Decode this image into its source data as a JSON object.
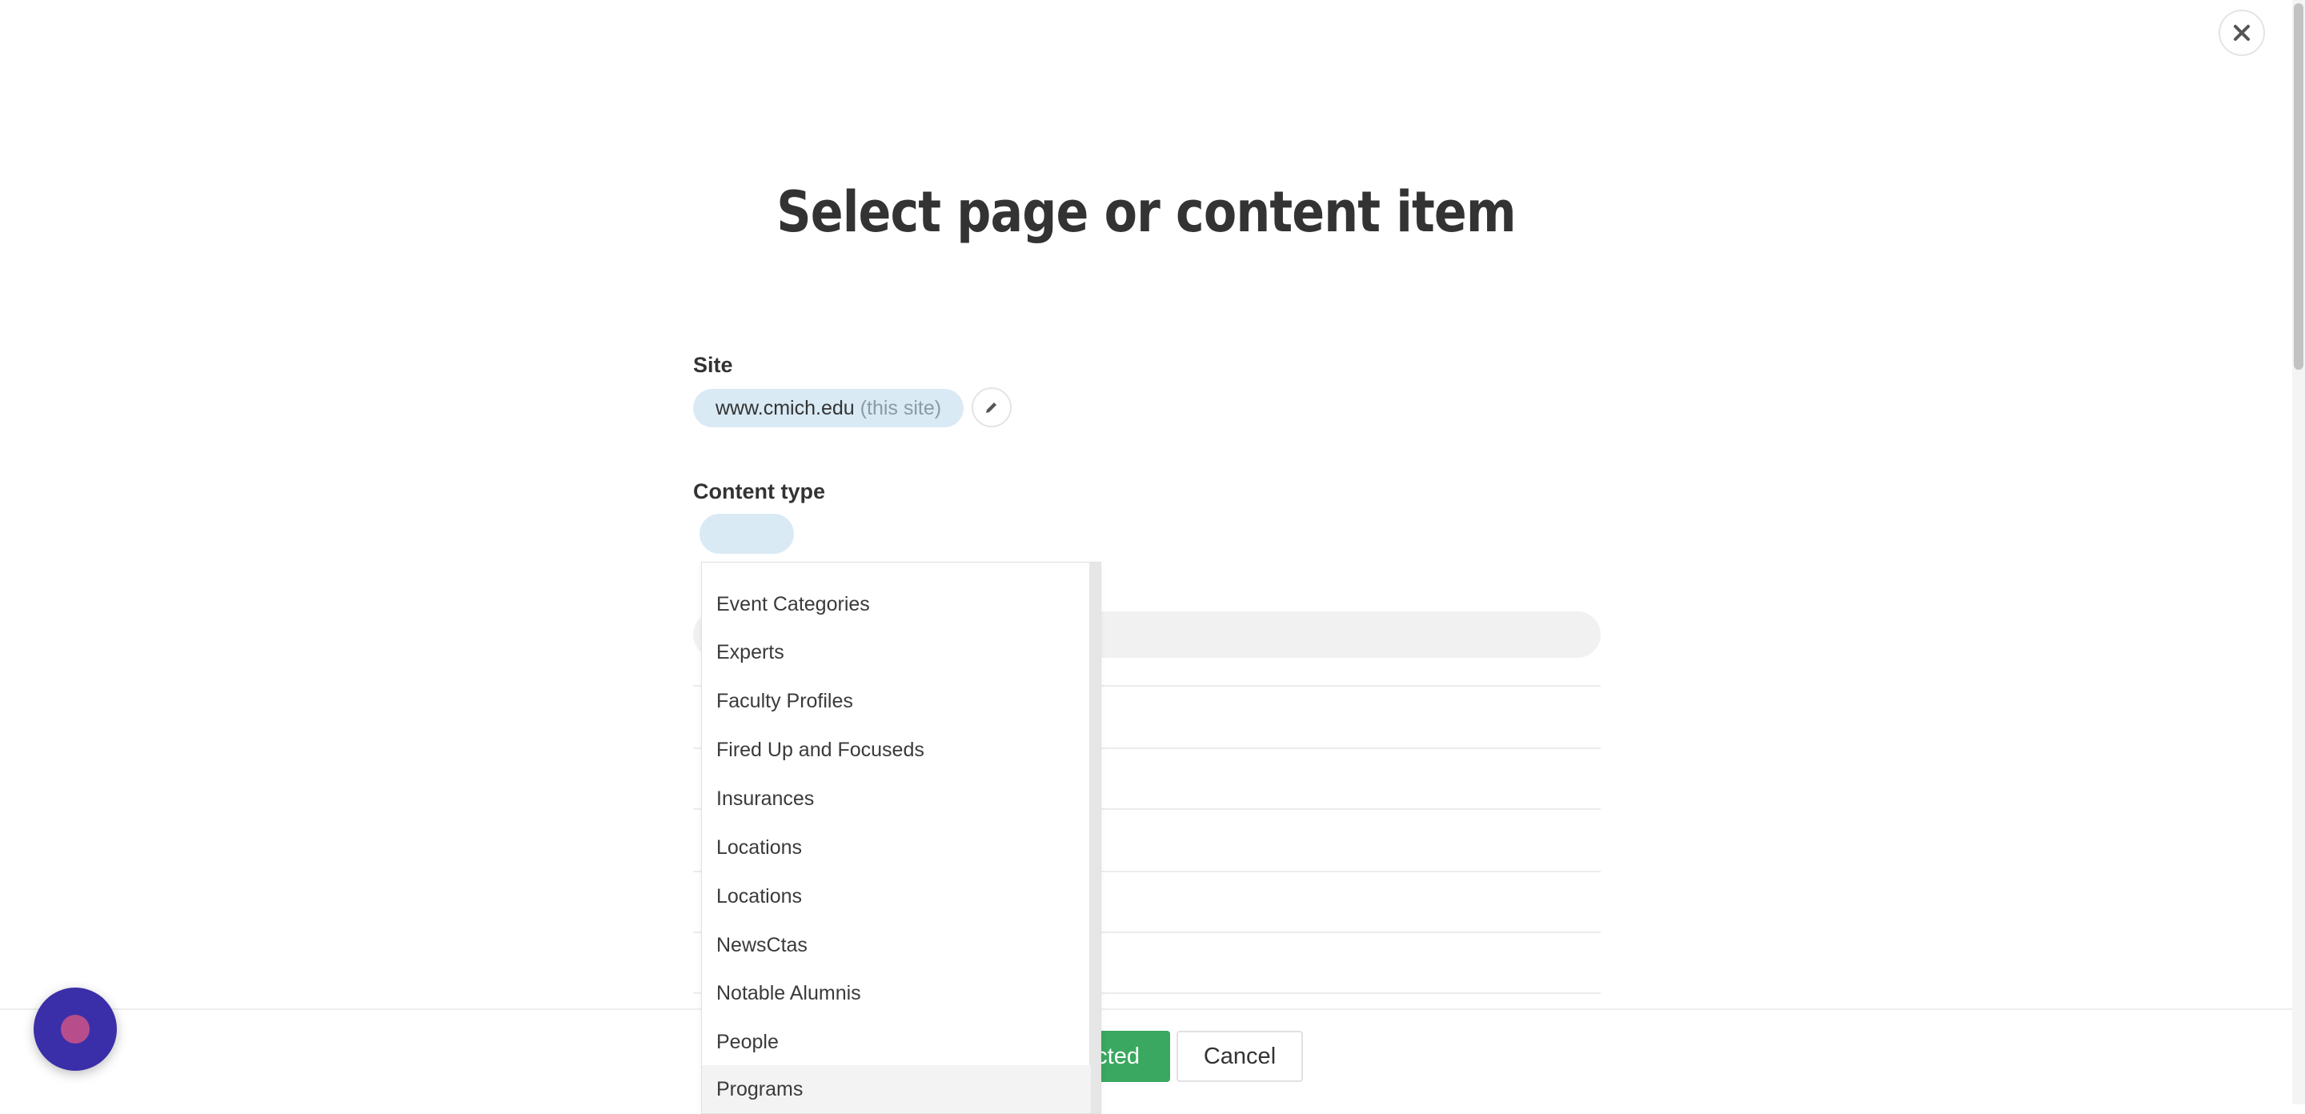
{
  "dialog": {
    "title": "Select page or content item"
  },
  "site": {
    "label": "Site",
    "value": "www.cmich.edu",
    "suffix": "(this site)"
  },
  "content_type": {
    "label": "Content type",
    "options": [
      "Event Categories",
      "Experts",
      "Faculty Profiles",
      "Fired Up and Focuseds",
      "Insurances",
      "Locations",
      "Locations",
      "NewsCtas",
      "Notable Alumnis",
      "People",
      "Programs"
    ],
    "hovered_option": "Programs"
  },
  "footer": {
    "select_label": "cted",
    "cancel_label": "Cancel"
  },
  "icons": {
    "close": "close-icon",
    "edit": "pencil-icon",
    "chat": "chat-launcher-icon"
  },
  "colors": {
    "pill": "#d9eaf5",
    "primary_button": "#3aa860",
    "chat_launcher": "#3a2fa8"
  }
}
